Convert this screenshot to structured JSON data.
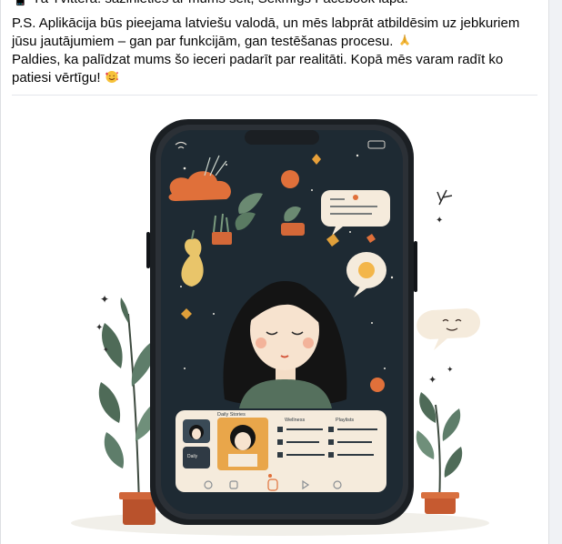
{
  "post": {
    "cut_line": "📱 Tā Tvitterā: sazinieties ar mums šeit, Sekmīgs Facebook lapā.",
    "para1_line1": "P.S. Aplikācija būs pieejama latviešu valodā, un mēs labprāt atbildēsim uz jebkuriem",
    "para1_line2": "jūsu jautājumiem – gan par funkcijām, gan testēšanas procesu.",
    "para2_line1": "Paldies, ka palīdzat mums šo ieceri padarīt par realitāti. Kopā mēs varam radīt ko",
    "para2_line2": "patiesi vērtīgu!",
    "icons": [
      "phone-emoji-icon",
      "praying-hands-emoji-icon",
      "smiling-face-hearts-emoji-icon"
    ]
  },
  "illustration": {
    "panel_labels": [
      "Daily Stories",
      "Wellness",
      "Playlists"
    ],
    "colors": {
      "phone_body": "#1b1f23",
      "screen_bg": "#1e2a33",
      "accent_orange": "#e0703a",
      "cream": "#f5ebdc",
      "leaf_green": "#5e7d6a"
    }
  }
}
